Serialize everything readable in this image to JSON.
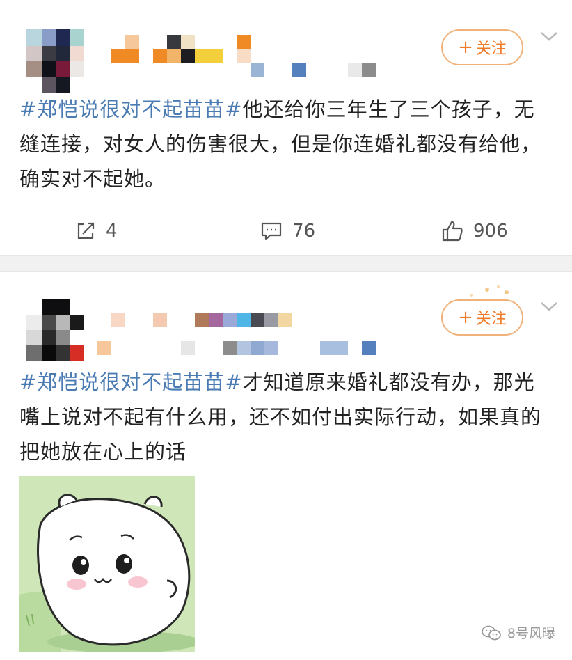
{
  "posts": [
    {
      "follow_label": "关注",
      "follow_plus": "+",
      "hashtag": "#郑恺说很对不起苗苗#",
      "text": "他还给你三年生了三个孩子，无缝连接，对女人的伤害很大，但是你连婚礼都没有给他，确实对不起她。",
      "actions": {
        "repost_count": "4",
        "comment_count": "76",
        "like_count": "906"
      }
    },
    {
      "follow_label": "关注",
      "follow_plus": "+",
      "hashtag": "#郑恺说很对不起苗苗#",
      "text": "才知道原来婚礼都没有办，那光嘴上说对不起有什么用，还不如付出实际行动，如果真的把她放在心上的话"
    }
  ],
  "watermark": {
    "label": "8号风曝"
  },
  "icons": {
    "repost": "repost-icon",
    "comment": "comment-icon",
    "like": "like-icon",
    "more": "chevron-down-icon",
    "watermark_logo": "wechat-logo-icon"
  },
  "colors": {
    "hashtag": "#4a7cb3",
    "follow": "#f07c2a",
    "follow_border": "#f0b27a",
    "divider": "#f1f1f1"
  }
}
